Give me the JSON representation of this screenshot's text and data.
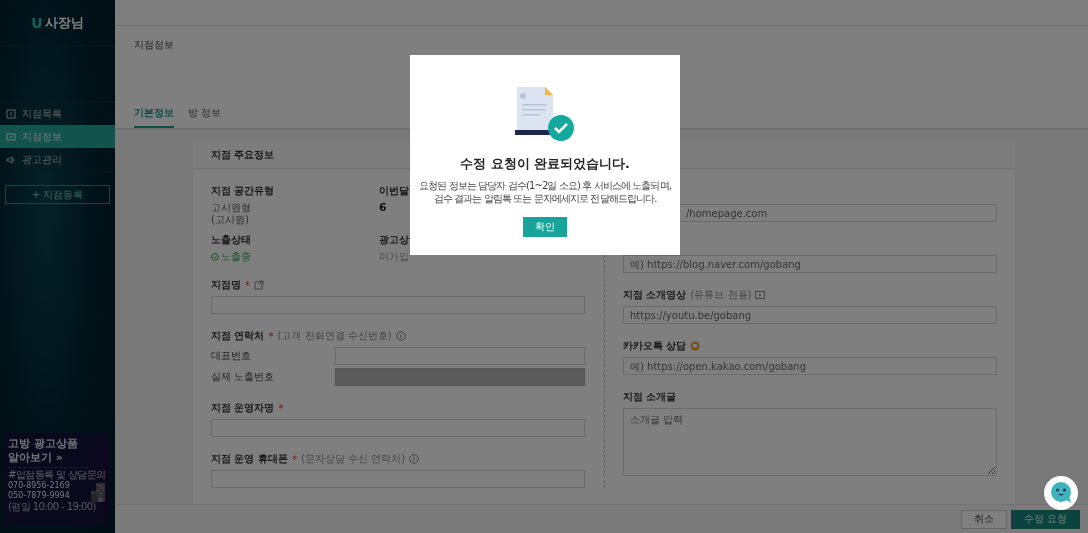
{
  "sidebar": {
    "logo_mark": "U",
    "logo_text": "사장님",
    "items": [
      {
        "label": "지점목록",
        "selected": false
      },
      {
        "label": "지점정보",
        "selected": true
      },
      {
        "label": "광고관리",
        "selected": false
      }
    ],
    "add_button": "+ 지점등록",
    "banner": {
      "title_lines": [
        "고방 광고상품",
        "알아보기 »"
      ],
      "caption": "#입점등록 및 상담문의",
      "phones": [
        "070-8956-2169",
        "050-7879-9994"
      ],
      "hours": "(평일 10:00 - 19:00)"
    }
  },
  "breadcrumb": "지점정보",
  "tabs": [
    {
      "label": "기본정보",
      "selected": true
    },
    {
      "label": "방 정보",
      "selected": false
    }
  ],
  "section_title": "지점 주요정보",
  "summary": [
    {
      "label": "지점 공간유형",
      "kind": "plain",
      "lines": [
        "고시원형",
        "(고시원)"
      ]
    },
    {
      "label": "이번달",
      "kind": "bold",
      "lines": [
        "6"
      ]
    },
    {
      "label": "노출상태",
      "kind": "status",
      "lines": [
        "노출중"
      ]
    },
    {
      "label": "광고상",
      "kind": "muted",
      "lines": [
        "미가입"
      ]
    }
  ],
  "left_fields": [
    {
      "label": "지점명",
      "required_mark": "*",
      "inputs": [
        {
          "disabled": false
        }
      ]
    },
    {
      "label": "지점 연락처",
      "required_mark": "*",
      "note": "(고객 전화연결 수신번호)",
      "inputs": [
        {
          "label": "대표번호",
          "disabled": false
        },
        {
          "label": "실제 노출번호",
          "disabled": true
        }
      ]
    },
    {
      "label": "지점 운영자명",
      "required_mark": "*",
      "inputs": [
        {
          "disabled": false
        }
      ]
    },
    {
      "label": "지점 운영 휴대폰",
      "required_mark": "*",
      "note": "(문자상담 수신 연락처)",
      "inputs": [
        {
          "disabled": false
        }
      ]
    }
  ],
  "right_fields": [
    {
      "kind": "input",
      "placeholder": "/homepage.com",
      "covered": true
    },
    {
      "kind": "input",
      "placeholder": "예) https://blog.naver.com/gobang"
    },
    {
      "kind": "input",
      "label": "지점 소개영상",
      "note": "(유튜브 전용)",
      "placeholder": "https://youtu.be/gobang"
    },
    {
      "kind": "input",
      "label": "카카오톡 상담",
      "placeholder": "예) https://open.kakao.com/gobang"
    },
    {
      "kind": "textarea",
      "label": "지점 소개글",
      "placeholder": "소개글 입력"
    }
  ],
  "footer_buttons": [
    {
      "label": "취소",
      "kind": "secondary"
    },
    {
      "label": "수정 요청",
      "kind": "primary"
    }
  ],
  "modal": {
    "title": "수정 요청이 완료되었습니다.",
    "message_lines": [
      "요청된 정보는 담당자 검수(1~2일 소요) 후 서비스에 노출되며,",
      "검수 결과는 알림톡 또는 문자메세지로 전달해드립니다."
    ],
    "button": "확인"
  }
}
